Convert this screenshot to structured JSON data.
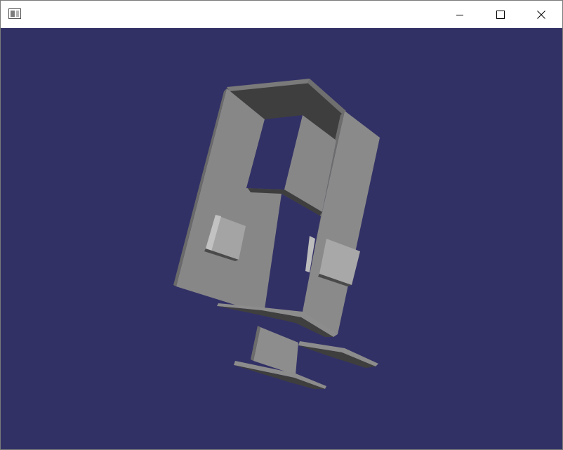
{
  "window": {
    "title": "",
    "icon": "app-window-icon",
    "controls": {
      "minimize_icon": "minimize-icon",
      "maximize_icon": "maximize-icon",
      "close_icon": "close-icon"
    }
  },
  "viewport": {
    "background_color": "#323166",
    "model_color": "#8a8a8a",
    "dark_face_color": "#3f3f3f",
    "light_face_color": "#a9a9a9"
  }
}
